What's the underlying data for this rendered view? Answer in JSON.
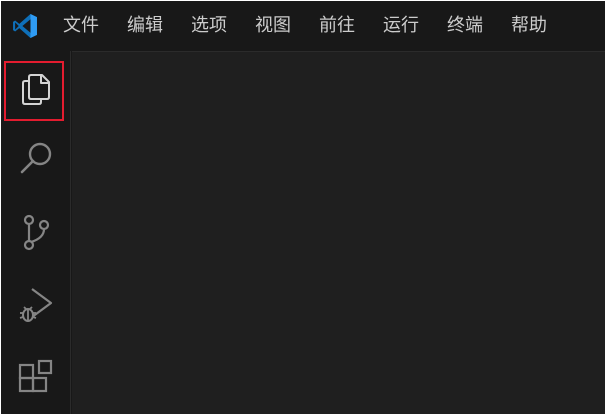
{
  "menubar": {
    "logo_icon": "vscode-logo-icon",
    "accent_color": "#2f9cf4",
    "items": [
      {
        "label": "文件"
      },
      {
        "label": "编辑"
      },
      {
        "label": "选项"
      },
      {
        "label": "视图"
      },
      {
        "label": "前往"
      },
      {
        "label": "运行"
      },
      {
        "label": "终端"
      },
      {
        "label": "帮助"
      }
    ]
  },
  "activitybar": {
    "items": [
      {
        "id": "explorer",
        "icon": "files-icon",
        "active": true
      },
      {
        "id": "search",
        "icon": "search-icon",
        "active": false
      },
      {
        "id": "source-control",
        "icon": "source-control-icon",
        "active": false
      },
      {
        "id": "run-debug",
        "icon": "run-debug-icon",
        "active": false
      },
      {
        "id": "extensions",
        "icon": "extensions-icon",
        "active": false
      }
    ],
    "highlight_color": "#e31c2f"
  }
}
